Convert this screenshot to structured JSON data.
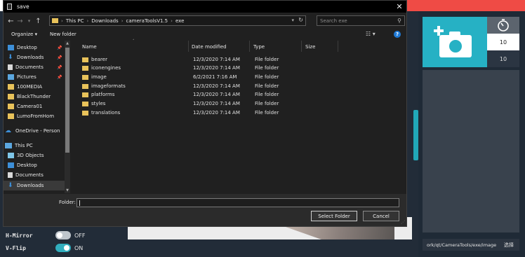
{
  "dialog": {
    "title": "save",
    "close_glyph": "✕",
    "breadcrumbs": [
      "This PC",
      "Downloads",
      "cameraToolsV1.5",
      "exe"
    ],
    "breadcrumb_sep": "›",
    "search_placeholder": "Search exe",
    "toolbar": {
      "organize": "Organize ▾",
      "new_folder": "New folder",
      "view_glyph": "☷ ▾",
      "help_glyph": "?"
    },
    "nav_pane": [
      {
        "label": "Desktop",
        "icon": "desktop-icon",
        "pinned": true
      },
      {
        "label": "Downloads",
        "icon": "download-icon",
        "pinned": true
      },
      {
        "label": "Documents",
        "icon": "document-icon",
        "pinned": true
      },
      {
        "label": "Pictures",
        "icon": "pictures-icon",
        "pinned": true
      },
      {
        "label": "100MEDIA",
        "icon": "folder-icon",
        "pinned": false
      },
      {
        "label": "BlackThunder",
        "icon": "folder-icon",
        "pinned": false
      },
      {
        "label": "Camera01",
        "icon": "folder-icon",
        "pinned": false
      },
      {
        "label": "LumoFromHom",
        "icon": "folder-icon",
        "pinned": false
      },
      {
        "label": "OneDrive - Person",
        "icon": "cloud-icon",
        "pinned": false
      },
      {
        "label": "This PC",
        "icon": "computer-icon",
        "pinned": false
      },
      {
        "label": "3D Objects",
        "icon": "cube-icon",
        "pinned": false
      },
      {
        "label": "Desktop",
        "icon": "desktop-icon",
        "pinned": false
      },
      {
        "label": "Documents",
        "icon": "document-icon",
        "pinned": false
      },
      {
        "label": "Downloads",
        "icon": "download-icon",
        "pinned": false,
        "selected": true
      }
    ],
    "columns": [
      "Name",
      "Date modified",
      "Type",
      "Size"
    ],
    "files": [
      {
        "name": "bearer",
        "date": "12/3/2020 7:14 AM",
        "type": "File folder"
      },
      {
        "name": "iconengines",
        "date": "12/3/2020 7:14 AM",
        "type": "File folder"
      },
      {
        "name": "image",
        "date": "6/2/2021 7:16 AM",
        "type": "File folder"
      },
      {
        "name": "imageformats",
        "date": "12/3/2020 7:14 AM",
        "type": "File folder"
      },
      {
        "name": "platforms",
        "date": "12/3/2020 7:14 AM",
        "type": "File folder"
      },
      {
        "name": "styles",
        "date": "12/3/2020 7:14 AM",
        "type": "File folder"
      },
      {
        "name": "translations",
        "date": "12/3/2020 7:14 AM",
        "type": "File folder"
      }
    ],
    "folder_label": "Folder:",
    "folder_value": "",
    "select_button": "Select Folder",
    "cancel_button": "Cancel"
  },
  "app": {
    "toggles": [
      {
        "label": "H-Mirror",
        "state": "OFF",
        "on": false
      },
      {
        "label": "V-Flip",
        "state": "ON",
        "on": true
      }
    ],
    "values": [
      "10",
      "10"
    ],
    "path_text": "ork/qt/CameraTools/exe/image",
    "browse_label": "选择",
    "colors": {
      "accent": "#26b1c4",
      "topbar_red": "#ef4b45"
    }
  }
}
